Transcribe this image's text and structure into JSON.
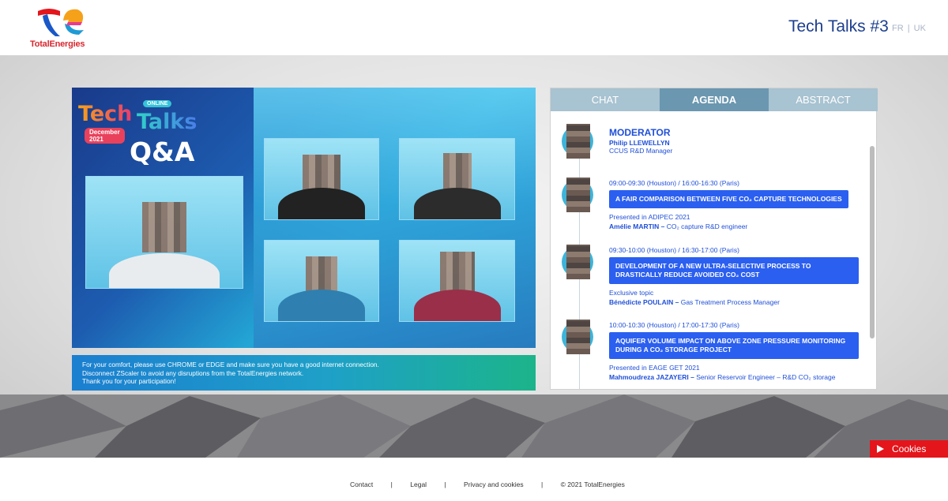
{
  "header": {
    "brand": "TotalEnergies",
    "event_title": "Tech Talks #3",
    "lang_fr": "FR",
    "lang_sep": "|",
    "lang_uk": "UK"
  },
  "video": {
    "logo_tech": "Tech",
    "logo_talks": "Talks",
    "logo_online": "ONLINE",
    "logo_date": "December 2021",
    "qa": "Q&A"
  },
  "info": {
    "line1": "For your comfort, please use CHROME or EDGE and make sure you have a good internet connection.",
    "line2": "Disconnect ZScaler to avoid any disruptions from the TotalEnergies network.",
    "line3": "Thank you for your participation!"
  },
  "tabs": [
    "CHAT",
    "AGENDA",
    "ABSTRACT"
  ],
  "agenda": {
    "moderator": {
      "title": "MODERATOR",
      "name": "Philip LLEWELLYN",
      "role": "CCUS R&D Manager"
    },
    "talks": [
      {
        "time": "09:00-09:30 (Houston) / 16:00-16:30 (Paris)",
        "title": "A FAIR COMPARISON BETWEEN FIVE CO₂ CAPTURE TECHNOLOGIES",
        "note": "Presented in ADIPEC 2021",
        "speaker": "Amélie MARTIN –",
        "speaker_role": "CO₂ capture R&D engineer"
      },
      {
        "time": "09:30-10:00 (Houston) / 16:30-17:00 (Paris)",
        "title": "DEVELOPMENT OF A NEW ULTRA-SELECTIVE PROCESS TO DRASTICALLY REDUCE AVOIDED CO₂ COST",
        "note": "Exclusive topic",
        "speaker": "Bénédicte POULAIN –",
        "speaker_role": "Gas Treatment Process Manager"
      },
      {
        "time": "10:00-10:30 (Houston) / 17:00-17:30 (Paris)",
        "title": "AQUIFER VOLUME IMPACT ON ABOVE ZONE PRESSURE MONITORING DURING A CO₂ STORAGE PROJECT",
        "note": "Presented in EAGE GET 2021",
        "speaker": "Mahmoudreza JAZAYERI –",
        "speaker_role": "Senior Reservoir Engineer – R&D CO₂ storage"
      }
    ]
  },
  "cookies": "Cookies",
  "footer": {
    "contact": "Contact",
    "legal": "Legal",
    "privacy": "Privacy and cookies",
    "copyright": "© 2021 TotalEnergies",
    "sep": "|"
  },
  "colors": {
    "brand_red": "#e4151b",
    "accent_blue": "#2b5ff0",
    "title_blue": "#1c3f8e",
    "tab_active": "#6b97b0",
    "tab_inactive": "#a8c3d1"
  }
}
